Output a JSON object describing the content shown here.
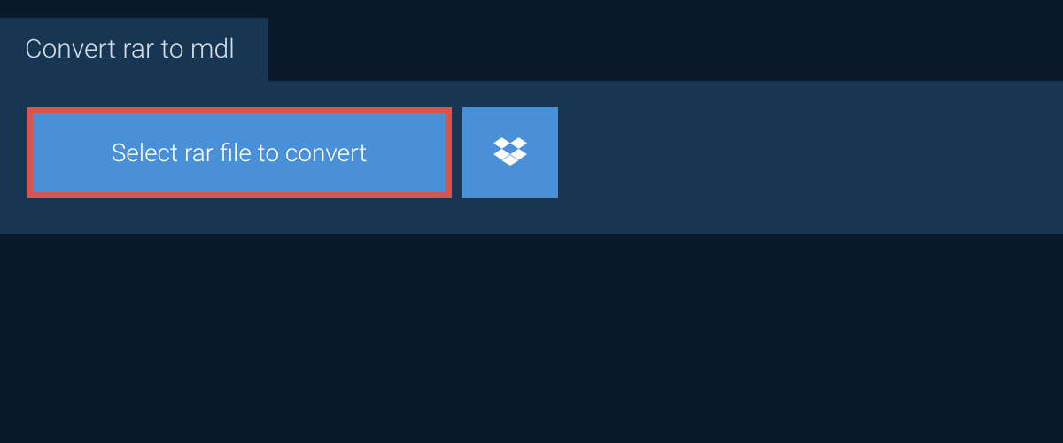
{
  "tab": {
    "title": "Convert rar to mdl"
  },
  "panel": {
    "select_button_label": "Select rar file to convert",
    "dropbox_icon": "dropbox-icon"
  }
}
